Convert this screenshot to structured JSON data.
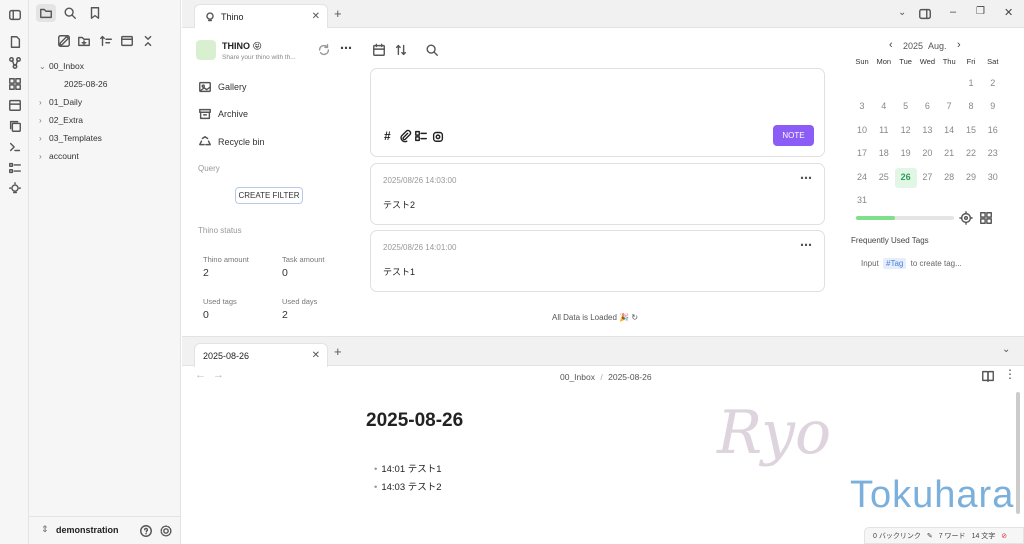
{
  "sidebar": {
    "tree": [
      {
        "label": "00_Inbox",
        "expanded": true
      },
      {
        "label": "2025-08-26",
        "child": true
      },
      {
        "label": "01_Daily",
        "expanded": false
      },
      {
        "label": "02_Extra",
        "expanded": false
      },
      {
        "label": "03_Templates",
        "expanded": false
      },
      {
        "label": "account",
        "expanded": false
      }
    ],
    "vault_name": "demonstration"
  },
  "top_tab": {
    "label": "Thino"
  },
  "thino": {
    "profile_name": "THINO 😝",
    "profile_sub": "Share your thino with th...",
    "nav": [
      "Gallery",
      "Archive",
      "Recycle bin"
    ],
    "query_label": "Query",
    "create_filter": "CREATE FILTER",
    "status_label": "Thino status",
    "stats": [
      {
        "label": "Thino amount",
        "value": "2"
      },
      {
        "label": "Task amount",
        "value": "0"
      },
      {
        "label": "Used tags",
        "value": "0"
      },
      {
        "label": "Used days",
        "value": "2"
      }
    ],
    "note_button": "NOTE",
    "memos": [
      {
        "time": "2025/08/26 14:03:00",
        "text": "テスト2"
      },
      {
        "time": "2025/08/26 14:01:00",
        "text": "テスト1"
      }
    ],
    "loaded": "All Data is Loaded 🎉 ↻"
  },
  "calendar": {
    "year": "2025",
    "month": "Aug.",
    "weekdays": [
      "Sun",
      "Mon",
      "Tue",
      "Wed",
      "Thu",
      "Fri",
      "Sat"
    ],
    "today": "26",
    "progress": 0.4,
    "tags_title": "Frequently Used Tags",
    "tag_hint_pre": "Input",
    "tag_hint_tag": "#Tag",
    "tag_hint_post": "to create tag..."
  },
  "bottom_tab": {
    "label": "2025-08-26"
  },
  "note": {
    "breadcrumb_folder": "00_Inbox",
    "breadcrumb_sep": "/",
    "breadcrumb_file": "2025-08-26",
    "title": "2025-08-26",
    "bullets": [
      "14:01 テスト1",
      "14:03 テスト2"
    ]
  },
  "watermark": {
    "script": "Ryo",
    "name": "Tokuhara"
  },
  "status": {
    "backlinks": "0 バックリンク",
    "words": "7 ワード",
    "chars": "14 文字"
  },
  "colors": {
    "accent": "#8b5cf6",
    "today": "#2e9e5b",
    "progress": "#7ee08a",
    "tag_bg": "#e6eefc",
    "watermark_blue": "#7ab0db"
  }
}
